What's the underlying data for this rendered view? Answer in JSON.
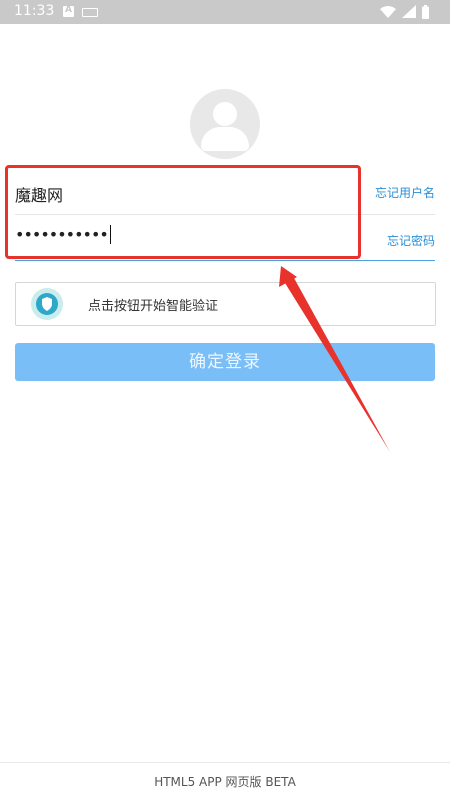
{
  "status_bar": {
    "time": "11:33",
    "a_icon_letter": "A",
    "icons": [
      "accessibility-icon",
      "keyboard-icon",
      "wifi-icon",
      "signal-icon",
      "battery-icon"
    ]
  },
  "login": {
    "username": "魔趣网",
    "forgot_username": "忘记用户名",
    "password_mask": "•••••••••••",
    "forgot_password": "忘记密码",
    "captcha_text": "点击按钮开始智能验证",
    "submit_label": "确定登录"
  },
  "footer": {
    "text": "HTML5 APP 网页版 BETA"
  },
  "colors": {
    "status_bar": "#c9c9c9",
    "link": "#2a8fd7",
    "button": "#79bef7",
    "highlight": "#e8322c",
    "active_underline": "#4aa3e0"
  }
}
